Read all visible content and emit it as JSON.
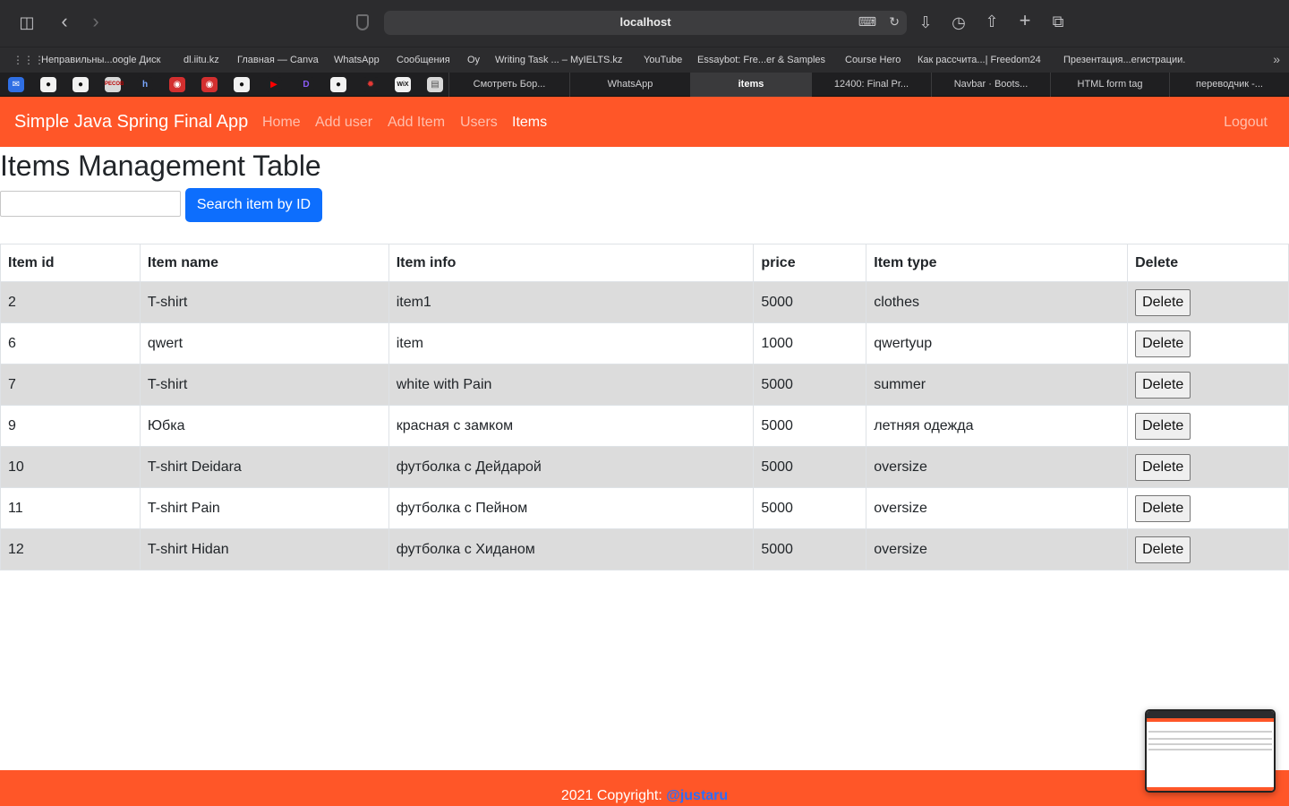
{
  "browser": {
    "url": "localhost",
    "bookmarks": [
      "Неправильны...oogle Диск",
      "dl.iitu.kz",
      "Главная — Canva",
      "WhatsApp",
      "Сообщения",
      "Оу",
      "Writing Task ... – MyIELTS.kz",
      "YouTube",
      "Essaybot: Fre...er & Samples",
      "Course Hero",
      "Как рассчита...| Freedom24",
      "Презентация...егистрации."
    ],
    "tabs": [
      "Смотреть Бор...",
      "WhatsApp",
      "items",
      "12400: Final Pr...",
      "Navbar · Boots...",
      "HTML form tag",
      "переводчик -..."
    ],
    "active_tab": 2,
    "pinned_icons": [
      "mail-icon",
      "github-icon",
      "github-icon",
      "pecob-icon",
      "h-icon",
      "iitu-icon",
      "iitu-icon",
      "github-icon",
      "youtube-icon",
      "d-icon",
      "github-icon",
      "spinner-icon",
      "wix-icon",
      "file-icon"
    ]
  },
  "navbar": {
    "brand": "Simple Java Spring Final App",
    "links": [
      "Home",
      "Add user",
      "Add Item",
      "Users",
      "Items"
    ],
    "active_link": "Items",
    "logout": "Logout"
  },
  "page": {
    "title": "Items Management Table",
    "search_value": "",
    "search_button": "Search item by ID"
  },
  "table": {
    "headers": [
      "Item id",
      "Item name",
      "Item info",
      "price",
      "Item type",
      "Delete"
    ],
    "delete_label": "Delete",
    "rows": [
      [
        "2",
        "T-shirt",
        "item1",
        "5000",
        "clothes"
      ],
      [
        "6",
        "qwert",
        "item",
        "1000",
        "qwertyup"
      ],
      [
        "7",
        "T-shirt",
        "white with Pain",
        "5000",
        "summer"
      ],
      [
        "9",
        "Юбка",
        "красная с замком",
        "5000",
        "летняя одежда"
      ],
      [
        "10",
        "T-shirt Deidara",
        "футболка с Дейдарой",
        "5000",
        "oversize"
      ],
      [
        "11",
        "T-shirt Pain",
        "футболка с Пейном",
        "5000",
        "oversize"
      ],
      [
        "12",
        "T-shirt Hidan",
        "футболка с Хиданом",
        "5000",
        "oversize"
      ]
    ]
  },
  "footer": {
    "text": "2021 Copyright: ",
    "link": "@justaru"
  },
  "colors": {
    "brand_orange": "#ff5628",
    "primary_blue": "#0d6efd",
    "stripe_gray": "#dcdcdc"
  }
}
